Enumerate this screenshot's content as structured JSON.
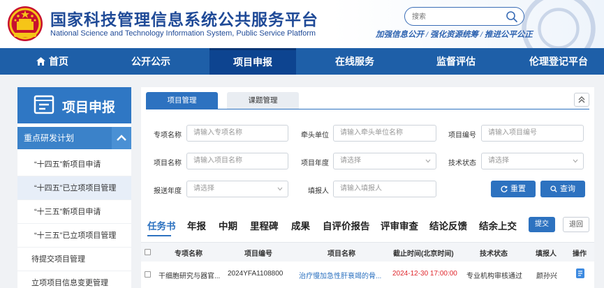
{
  "header": {
    "title": "国家科技管理信息系统公共服务平台",
    "subtitle": "National Science and Technology Information System, Public Service Platform",
    "search_placeholder": "搜索",
    "slogan": "加强信息公开 / 强化资源统筹 / 推进公平公正"
  },
  "nav": {
    "items": [
      {
        "label": "首页"
      },
      {
        "label": "公开公示"
      },
      {
        "label": "项目申报"
      },
      {
        "label": "在线服务"
      },
      {
        "label": "监督评估"
      },
      {
        "label": "伦理登记平台"
      }
    ],
    "active": "项目申报"
  },
  "sidebar": {
    "title": "项目申报",
    "group": "重点研发计划",
    "items": [
      {
        "label": "“十四五”新项目申请"
      },
      {
        "label": "“十四五”已立项项目管理"
      },
      {
        "label": "“十三五”新项目申请"
      },
      {
        "label": "“十三五”已立项项目管理"
      },
      {
        "label": "待提交项目管理"
      },
      {
        "label": "立项项目信息变更管理"
      }
    ]
  },
  "tabs": [
    {
      "label": "项目管理"
    },
    {
      "label": "课题管理"
    }
  ],
  "form": {
    "labels": {
      "special": "专项名称",
      "lead_unit": "牵头单位",
      "project_no": "项目编号",
      "project_name": "项目名称",
      "project_year": "项目年度",
      "tech_status": "技术状态",
      "submit_year": "报送年度",
      "reporter": "填报人"
    },
    "placeholders": {
      "special": "请输入专项名称",
      "lead_unit": "请输入牵头单位名称",
      "project_no": "请输入项目编号",
      "project_name": "请输入项目名称",
      "project_year": "请选择",
      "tech_status": "请选择",
      "submit_year": "请选择",
      "reporter": "请输入填报人"
    },
    "reset_label": "重置",
    "query_label": "查询"
  },
  "subtabs": {
    "items": [
      {
        "label": "任务书"
      },
      {
        "label": "年报"
      },
      {
        "label": "中期"
      },
      {
        "label": "里程碑"
      },
      {
        "label": "成果"
      },
      {
        "label": "自评价报告"
      },
      {
        "label": "评审审查"
      },
      {
        "label": "结论反馈"
      },
      {
        "label": "结余上交"
      }
    ],
    "submit_label": "提交",
    "return_label": "退回"
  },
  "table": {
    "columns": [
      "专项名称",
      "项目编号",
      "项目名称",
      "截止时间(北京时间)",
      "技术状态",
      "填报人",
      "操作"
    ],
    "rows": [
      {
        "special": "干细胞研究与器官...",
        "number": "2024YFA1108800",
        "name": "治疗慢加急性肝衰竭的骨...",
        "deadline": "2024-12-30 17:00:00",
        "status": "专业机构审核通过",
        "reporter": "颜孙兴"
      }
    ]
  },
  "colors": {
    "primary": "#1e5fa8",
    "nav_active": "#0d4490",
    "accent_blue": "#2d72c0",
    "deadline_red": "#e0272d",
    "link_blue": "#2d72c0"
  }
}
